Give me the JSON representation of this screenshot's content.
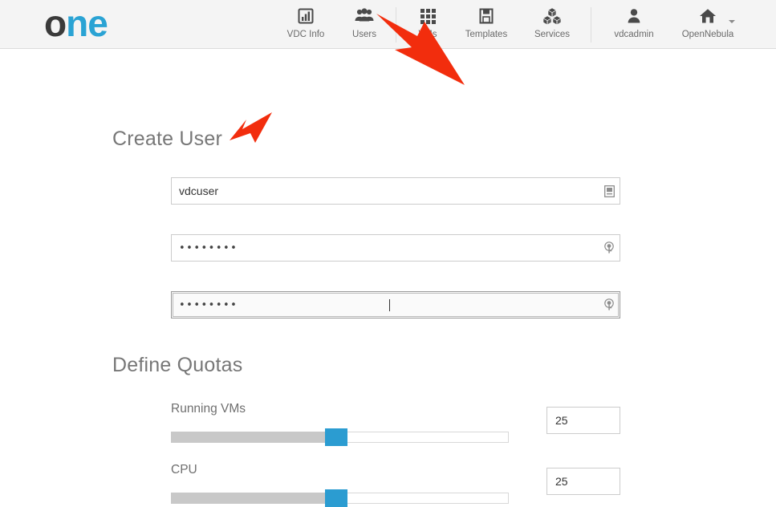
{
  "header": {
    "logo": {
      "part1": "o",
      "part2": "ne",
      "color_dark": "#3a3a3a",
      "color_blue": "#2aa3d4"
    },
    "nav": [
      {
        "label": "VDC Info",
        "icon": "bar-chart-icon"
      },
      {
        "label": "Users",
        "icon": "users-icon"
      },
      {
        "label": "VMs",
        "icon": "grid-icon"
      },
      {
        "label": "Templates",
        "icon": "floppy-disk-icon"
      },
      {
        "label": "Services",
        "icon": "cubes-icon"
      },
      {
        "label": "vdcadmin",
        "icon": "user-icon"
      },
      {
        "label": "OpenNebula",
        "icon": "home-icon"
      }
    ]
  },
  "main": {
    "create_user_title": "Create User",
    "define_quotas_title": "Define Quotas",
    "fields": {
      "username": {
        "value": "vdcuser",
        "icon": "contact-card-icon"
      },
      "password": {
        "value": "••••••••",
        "icon": "key-icon"
      },
      "confirm_password": {
        "value": "••••••••",
        "icon": "key-icon",
        "focused": "true"
      }
    },
    "quotas": [
      {
        "label": "Running VMs",
        "value": "25",
        "slider_percent": 49
      },
      {
        "label": "CPU",
        "value": "25",
        "slider_percent": 49
      }
    ]
  },
  "annotations": {
    "arrow_color": "#f22d0d",
    "arrows": [
      {
        "name": "arrow-to-users-nav",
        "target": "Users"
      },
      {
        "name": "arrow-to-username-field",
        "target": "vdcuser"
      }
    ]
  }
}
